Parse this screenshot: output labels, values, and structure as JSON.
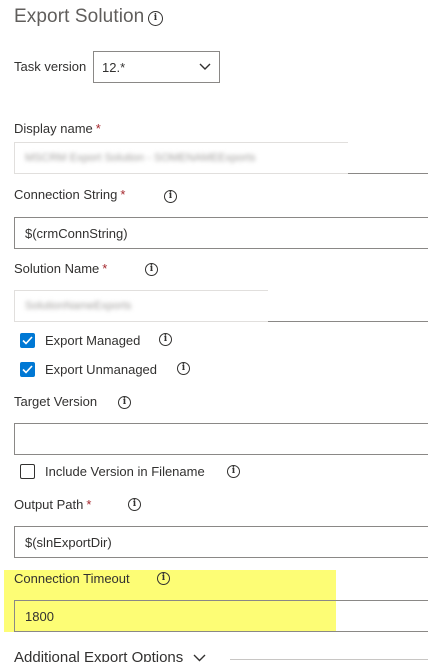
{
  "section": {
    "title": "Export Solution"
  },
  "task_version": {
    "label": "Task version",
    "value": "12.*"
  },
  "display_name": {
    "label": "Display name",
    "required_mark": "*",
    "value": "MSCRM Export Solution - SOMENAMEExports"
  },
  "connection_string": {
    "label": "Connection String",
    "required_mark": "*",
    "value": "$(crmConnString)"
  },
  "solution_name": {
    "label": "Solution Name",
    "required_mark": "*",
    "value": "SolutionNameExports"
  },
  "export_managed": {
    "label": "Export Managed",
    "checked": true
  },
  "export_unmanaged": {
    "label": "Export Unmanaged",
    "checked": true
  },
  "target_version": {
    "label": "Target Version",
    "value": ""
  },
  "include_version": {
    "label": "Include Version in Filename",
    "checked": false
  },
  "output_path": {
    "label": "Output Path",
    "required_mark": "*",
    "value": "$(slnExportDir)"
  },
  "connection_timeout": {
    "label": "Connection Timeout",
    "value": "1800"
  },
  "additional_options": {
    "label": "Additional Export Options"
  },
  "colors": {
    "accent": "#0078d4",
    "highlight": "#fdfd75",
    "required": "#a4262c"
  }
}
